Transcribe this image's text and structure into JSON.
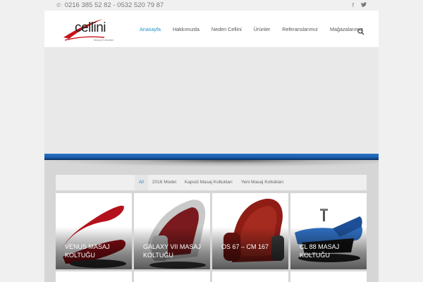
{
  "topbar": {
    "phone": "0216 385 52 82 - 0532 520 79 87",
    "phone_icon": "phone-icon",
    "social_icons": [
      "facebook-icon",
      "twitter-icon"
    ]
  },
  "logo": {
    "name": "cellini",
    "tagline": "Masaj Koltukları"
  },
  "nav": {
    "items": [
      "Anasayfa",
      "Hakkımızda",
      "Neden Cellini",
      "Ürünler",
      "Referanslarımız",
      "Mağazalarımız"
    ],
    "active": "Anasayfa",
    "search_icon": "search-icon"
  },
  "filters": {
    "items": [
      "All",
      "2016 Model",
      "Kapsül Masaj Koltukları",
      "Yeni Masaj Koltukları"
    ],
    "active": "All"
  },
  "products": [
    {
      "title": "VENUS MASAJ KOLTUĞU",
      "color": "#b3121c"
    },
    {
      "title": "GALAXY VII MASAJ KOLTUĞU",
      "color": "#7a1a1e"
    },
    {
      "title": "OS 67 – CM 167",
      "color": "#8f1d16"
    },
    {
      "title": "CL 88 MASAJ KOLTUĞU",
      "color": "#2f6fc0"
    }
  ],
  "colors": {
    "accent": "#1e90c8",
    "band": "#1a5fb0"
  }
}
